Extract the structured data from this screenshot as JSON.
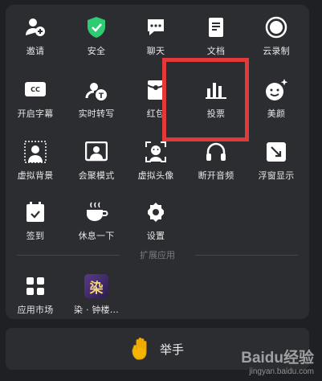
{
  "grid": {
    "row1": [
      "邀请",
      "安全",
      "聊天",
      "文档",
      "云录制"
    ],
    "row2": [
      "开启字幕",
      "实时转写",
      "红包",
      "投票",
      "美颜"
    ],
    "row3": [
      "虚拟背景",
      "会聚模式",
      "虚拟头像",
      "断开音频",
      "浮窗显示"
    ],
    "row4": [
      "签到",
      "休息一下",
      "设置"
    ]
  },
  "extensions": {
    "section_label": "扩展应用",
    "items": [
      "应用市场",
      "染 · 钟楼…"
    ],
    "app_icon_char": "染"
  },
  "hand": {
    "label": "举手"
  },
  "watermark": {
    "brand": "Baidu经验",
    "url": "jingyan.baidu.com"
  },
  "colors": {
    "accent_green": "#2ecc71",
    "highlight_red": "#e23a3a"
  }
}
